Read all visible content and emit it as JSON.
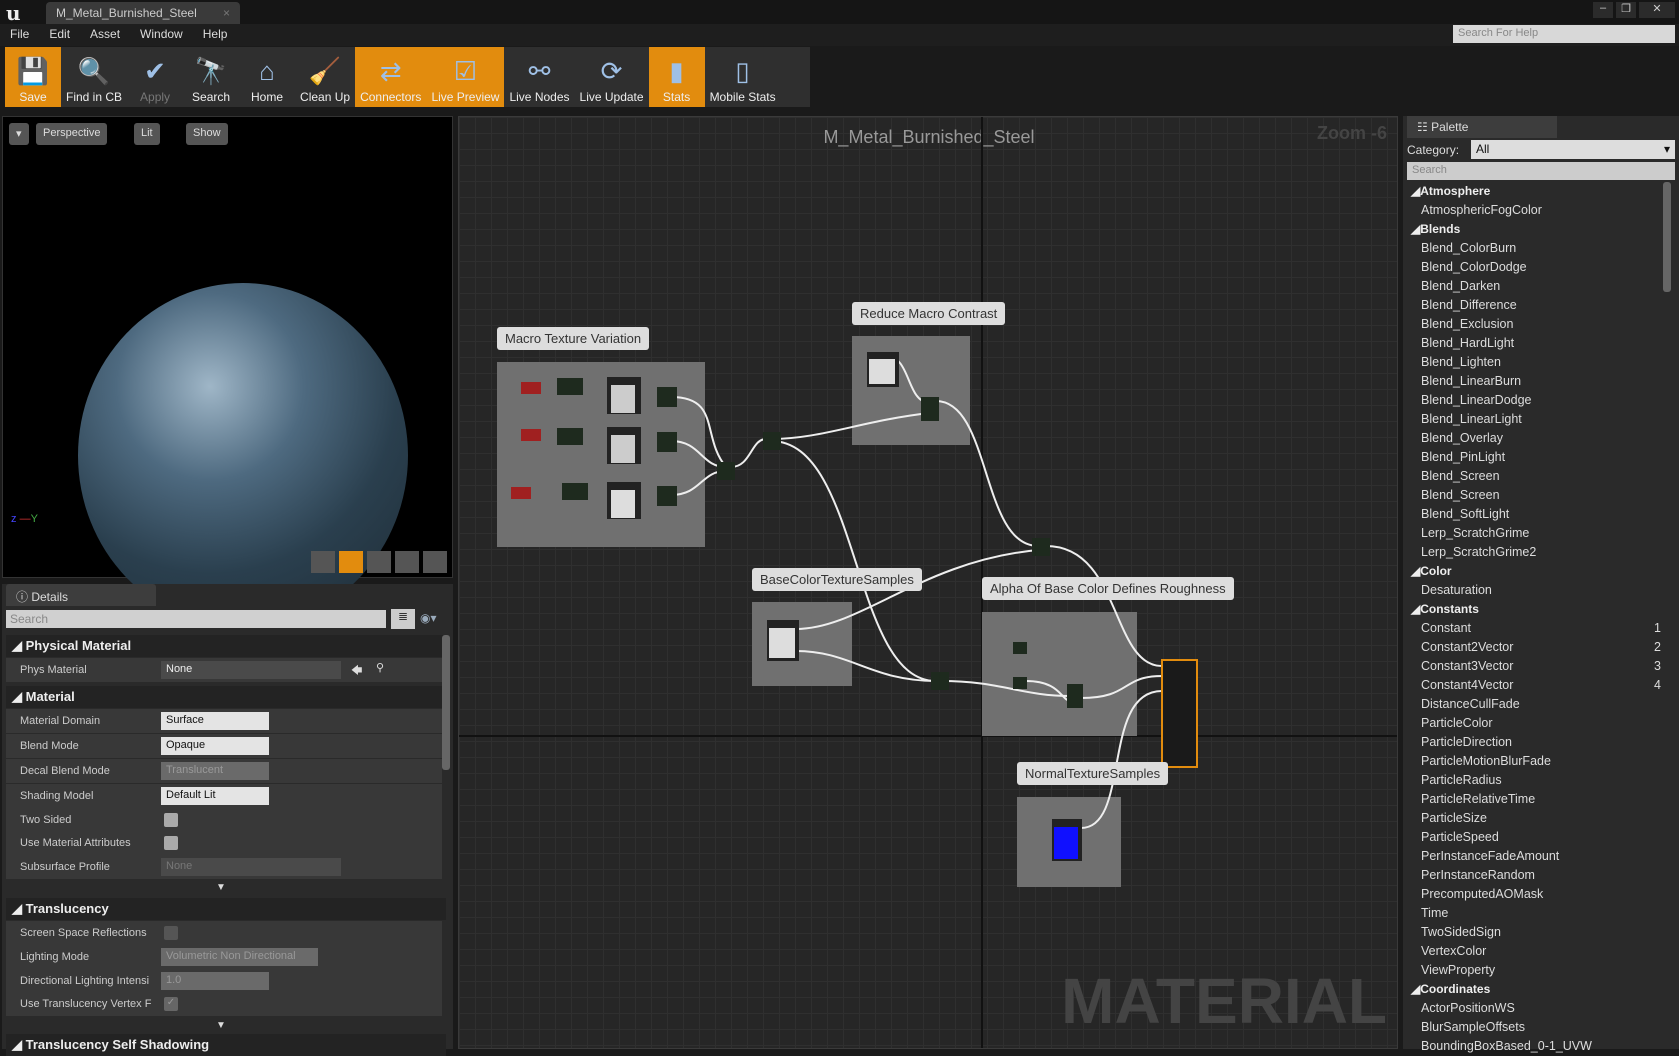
{
  "window": {
    "doc_tab": "M_Metal_Burnished_Steel",
    "help_search_placeholder": "Search For Help"
  },
  "menu": [
    "File",
    "Edit",
    "Asset",
    "Window",
    "Help"
  ],
  "toolbar": [
    {
      "label": "Save",
      "icon": "save-icon",
      "active": true
    },
    {
      "label": "Find in CB",
      "icon": "magnifier-icon",
      "active": false
    },
    {
      "label": "Apply",
      "icon": "checkmark-icon",
      "active": false,
      "disabled": true
    },
    {
      "label": "Search",
      "icon": "binoculars-icon",
      "active": false
    },
    {
      "label": "Home",
      "icon": "home-icon",
      "active": false
    },
    {
      "label": "Clean Up",
      "icon": "broom-icon",
      "active": false
    },
    {
      "label": "Connectors",
      "icon": "connectors-icon",
      "active": true
    },
    {
      "label": "Live Preview",
      "icon": "tv-check-icon",
      "active": true
    },
    {
      "label": "Live Nodes",
      "icon": "live-nodes-icon",
      "active": false
    },
    {
      "label": "Live Update",
      "icon": "live-update-icon",
      "active": false
    },
    {
      "label": "Stats",
      "icon": "bar-stats-icon",
      "active": true
    },
    {
      "label": "Mobile Stats",
      "icon": "mobile-stats-icon",
      "active": false
    }
  ],
  "viewport": {
    "perspective": "Perspective",
    "lit": "Lit",
    "show": "Show"
  },
  "details": {
    "tab": "Details",
    "search_placeholder": "Search",
    "physical_material": {
      "title": "Physical Material",
      "phys_label": "Phys Material",
      "phys_value": "None"
    },
    "material": {
      "title": "Material",
      "rows": [
        {
          "label": "Material Domain",
          "value": "Surface"
        },
        {
          "label": "Blend Mode",
          "value": "Opaque"
        },
        {
          "label": "Decal Blend Mode",
          "value": "Translucent",
          "disabled": true
        },
        {
          "label": "Shading Model",
          "value": "Default Lit"
        }
      ],
      "two_sided": "Two Sided",
      "use_attrs": "Use Material Attributes",
      "subsurface_label": "Subsurface Profile",
      "subsurface_value": "None"
    },
    "translucency": {
      "title": "Translucency",
      "ssr": "Screen Space Reflections",
      "lighting_label": "Lighting Mode",
      "lighting_value": "Volumetric Non Directional",
      "dir_label": "Directional Lighting Intensi",
      "dir_value": "1.0",
      "vertex_label": "Use Translucency Vertex F",
      "vertex_checked": true
    },
    "self_shadow_title": "Translucency Self Shadowing"
  },
  "graph": {
    "title": "M_Metal_Burnished_Steel",
    "zoom": "Zoom -6",
    "watermark": "MATERIAL",
    "comments": [
      "Macro Texture Variation",
      "Reduce Macro Contrast",
      "BaseColorTextureSamples",
      "Alpha Of Base Color Defines Roughness",
      "NormalTextureSamples"
    ],
    "colors": {
      "param": "#a02020",
      "texture_header": "#2a6a9a",
      "normal_preview": "#1010ff",
      "result_border": "#e28c0e"
    }
  },
  "palette": {
    "tab": "Palette",
    "category_label": "Category:",
    "category_value": "All",
    "search_placeholder": "Search",
    "groups": [
      {
        "name": "Atmosphere",
        "items": [
          "AtmosphericFogColor"
        ]
      },
      {
        "name": "Blends",
        "items": [
          "Blend_ColorBurn",
          "Blend_ColorDodge",
          "Blend_Darken",
          "Blend_Difference",
          "Blend_Exclusion",
          "Blend_HardLight",
          "Blend_Lighten",
          "Blend_LinearBurn",
          "Blend_LinearDodge",
          "Blend_LinearLight",
          "Blend_Overlay",
          "Blend_PinLight",
          "Blend_Screen",
          "Blend_Screen",
          "Blend_SoftLight",
          "Lerp_ScratchGrime",
          "Lerp_ScratchGrime2"
        ]
      },
      {
        "name": "Color",
        "items": [
          "Desaturation"
        ]
      },
      {
        "name": "Constants",
        "items": [
          "Constant",
          "Constant2Vector",
          "Constant3Vector",
          "Constant4Vector",
          "DistanceCullFade",
          "ParticleColor",
          "ParticleDirection",
          "ParticleMotionBlurFade",
          "ParticleRadius",
          "ParticleRelativeTime",
          "ParticleSize",
          "ParticleSpeed",
          "PerInstanceFadeAmount",
          "PerInstanceRandom",
          "PrecomputedAOMask",
          "Time",
          "TwoSidedSign",
          "VertexColor",
          "ViewProperty"
        ],
        "keys": [
          "1",
          "2",
          "3",
          "4"
        ]
      },
      {
        "name": "Coordinates",
        "items": [
          "ActorPositionWS",
          "BlurSampleOffsets",
          "BoundingBoxBased_0-1_UVW"
        ]
      }
    ]
  }
}
